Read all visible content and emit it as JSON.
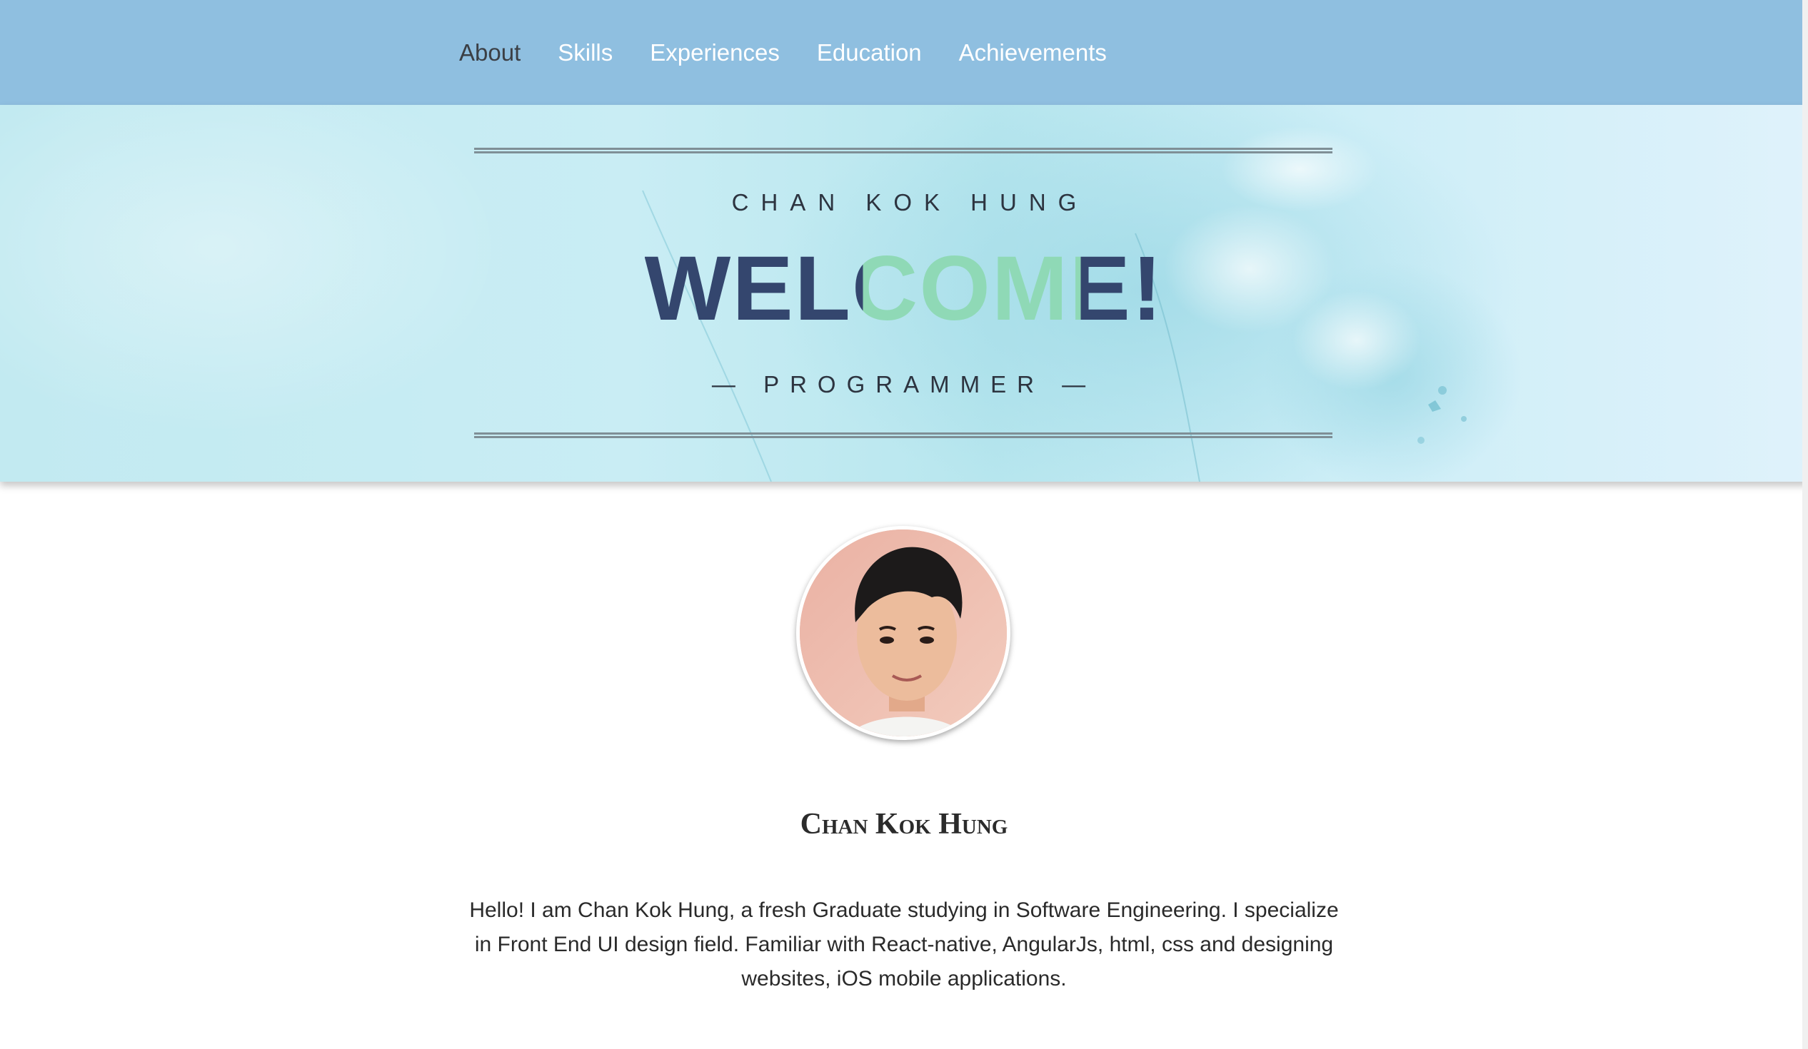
{
  "nav": {
    "items": [
      {
        "label": "About",
        "active": true
      },
      {
        "label": "Skills",
        "active": false
      },
      {
        "label": "Experiences",
        "active": false
      },
      {
        "label": "Education",
        "active": false
      },
      {
        "label": "Achievements",
        "active": false
      }
    ]
  },
  "hero": {
    "name": "CHAN KOK HUNG",
    "welcome": "WELCOME!",
    "role": "— PROGRAMMER —"
  },
  "profile": {
    "name": "Chan Kok Hung",
    "bio": "Hello! I am Chan Kok Hung, a fresh Graduate studying in Software Engineering. I specialize in Front End UI design field. Familiar with React-native, AngularJs, html, css and designing websites, iOS mobile applications."
  },
  "colors": {
    "navbar": "#8fbfe0",
    "welcome_dark": "#34466e",
    "welcome_green": "#8fd9b6"
  }
}
